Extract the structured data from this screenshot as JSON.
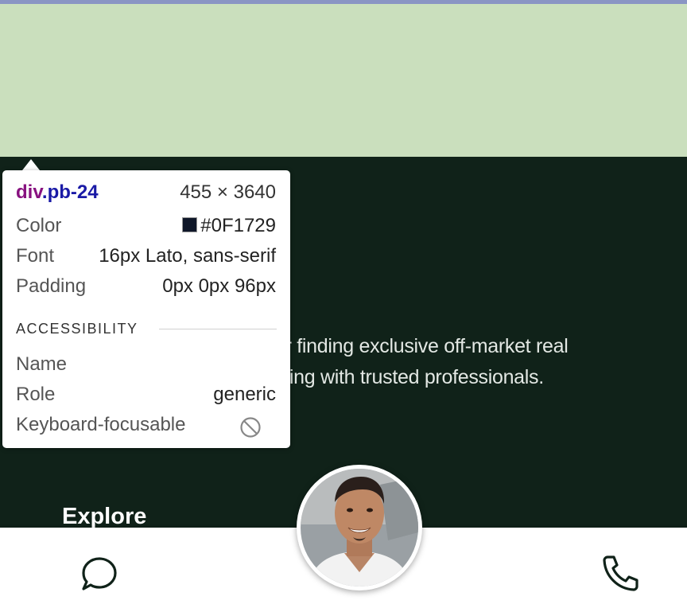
{
  "page": {
    "description": "or finding exclusive off-market real\ncting with trusted professionals.",
    "explore_heading": "Explore"
  },
  "bottom_nav": {
    "chat_icon": "chat-bubble-icon",
    "phone_icon": "phone-icon",
    "avatar_icon": "agent-avatar-photo"
  },
  "inspector": {
    "element_tag": "div",
    "element_class": ".pb-24",
    "element_size": "455 × 3640",
    "rows": [
      {
        "label": "Color",
        "value": "#0F1729"
      },
      {
        "label": "Font",
        "value": "16px Lato, sans-serif"
      },
      {
        "label": "Padding",
        "value": "0px 0px 96px"
      }
    ],
    "accessibility_header": "ACCESSIBILITY",
    "accessibility": [
      {
        "label": "Name",
        "value": ""
      },
      {
        "label": "Role",
        "value": "generic"
      },
      {
        "label": "Keyboard-focusable",
        "value": ""
      }
    ],
    "keyboard_focusable_icon": "not-allowed-icon"
  },
  "colors": {
    "top_bar": "#8a95c4",
    "green_band": "#cadfbd",
    "dark_section": "#102219",
    "swatch": "#0F1729"
  }
}
